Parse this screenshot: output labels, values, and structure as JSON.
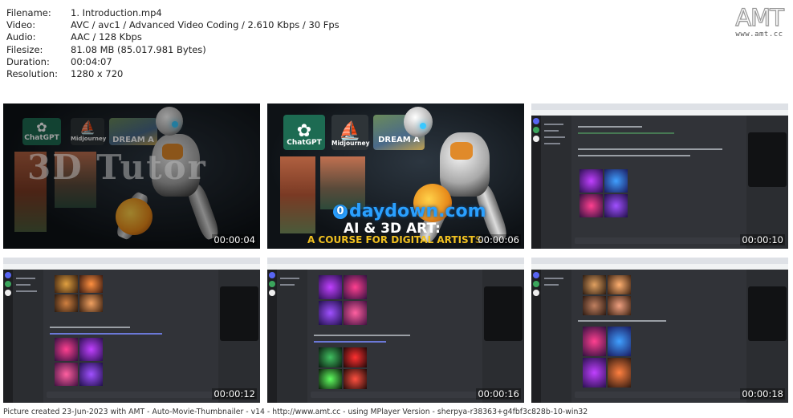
{
  "info": {
    "rows": [
      {
        "key": "Filename:",
        "value": "1. Introduction.mp4"
      },
      {
        "key": "Video:",
        "value": "AVC / avc1 / Advanced Video Coding / 2.610 Kbps / 30 Fps"
      },
      {
        "key": "Audio:",
        "value": "AAC / 128 Kbps"
      },
      {
        "key": "Filesize:",
        "value": "81.08 MB (85.017.981 Bytes)"
      },
      {
        "key": "Duration:",
        "value": "00:04:07"
      },
      {
        "key": "Resolution:",
        "value": "1280 x 720"
      }
    ]
  },
  "logo": {
    "big": "AMT",
    "small": "www.amt.cc"
  },
  "thumbnails": [
    {
      "timestamp": "00:00:04"
    },
    {
      "timestamp": "00:00:06"
    },
    {
      "timestamp": "00:00:10"
    },
    {
      "timestamp": "00:00:12"
    },
    {
      "timestamp": "00:00:16"
    },
    {
      "timestamp": "00:00:18"
    }
  ],
  "promo": {
    "tile_chatgpt": "ChatGPT",
    "tile_midjourney": "Midjourney",
    "tile_dream": "DREAM A",
    "title_3d": "3D Tutor",
    "brand": "daydown.com",
    "brand_mark": "0",
    "headline": "AI & 3D ART:",
    "subline": "A COURSE FOR DIGITAL ARTISTS"
  },
  "footer": "Picture created 23-Jun-2023 with AMT - Auto-Movie-Thumbnailer - v14 - http://www.amt.cc - using MPlayer Version - sherpya-r38363+g4fbf3c828b-10-win32",
  "colors": {
    "discord_bg": "#313338",
    "discord_sidebar": "#2b2d31",
    "discord_blurple": "#5865f2",
    "brand_blue": "#2aa0ff",
    "subline_yellow": "#f0c020"
  }
}
